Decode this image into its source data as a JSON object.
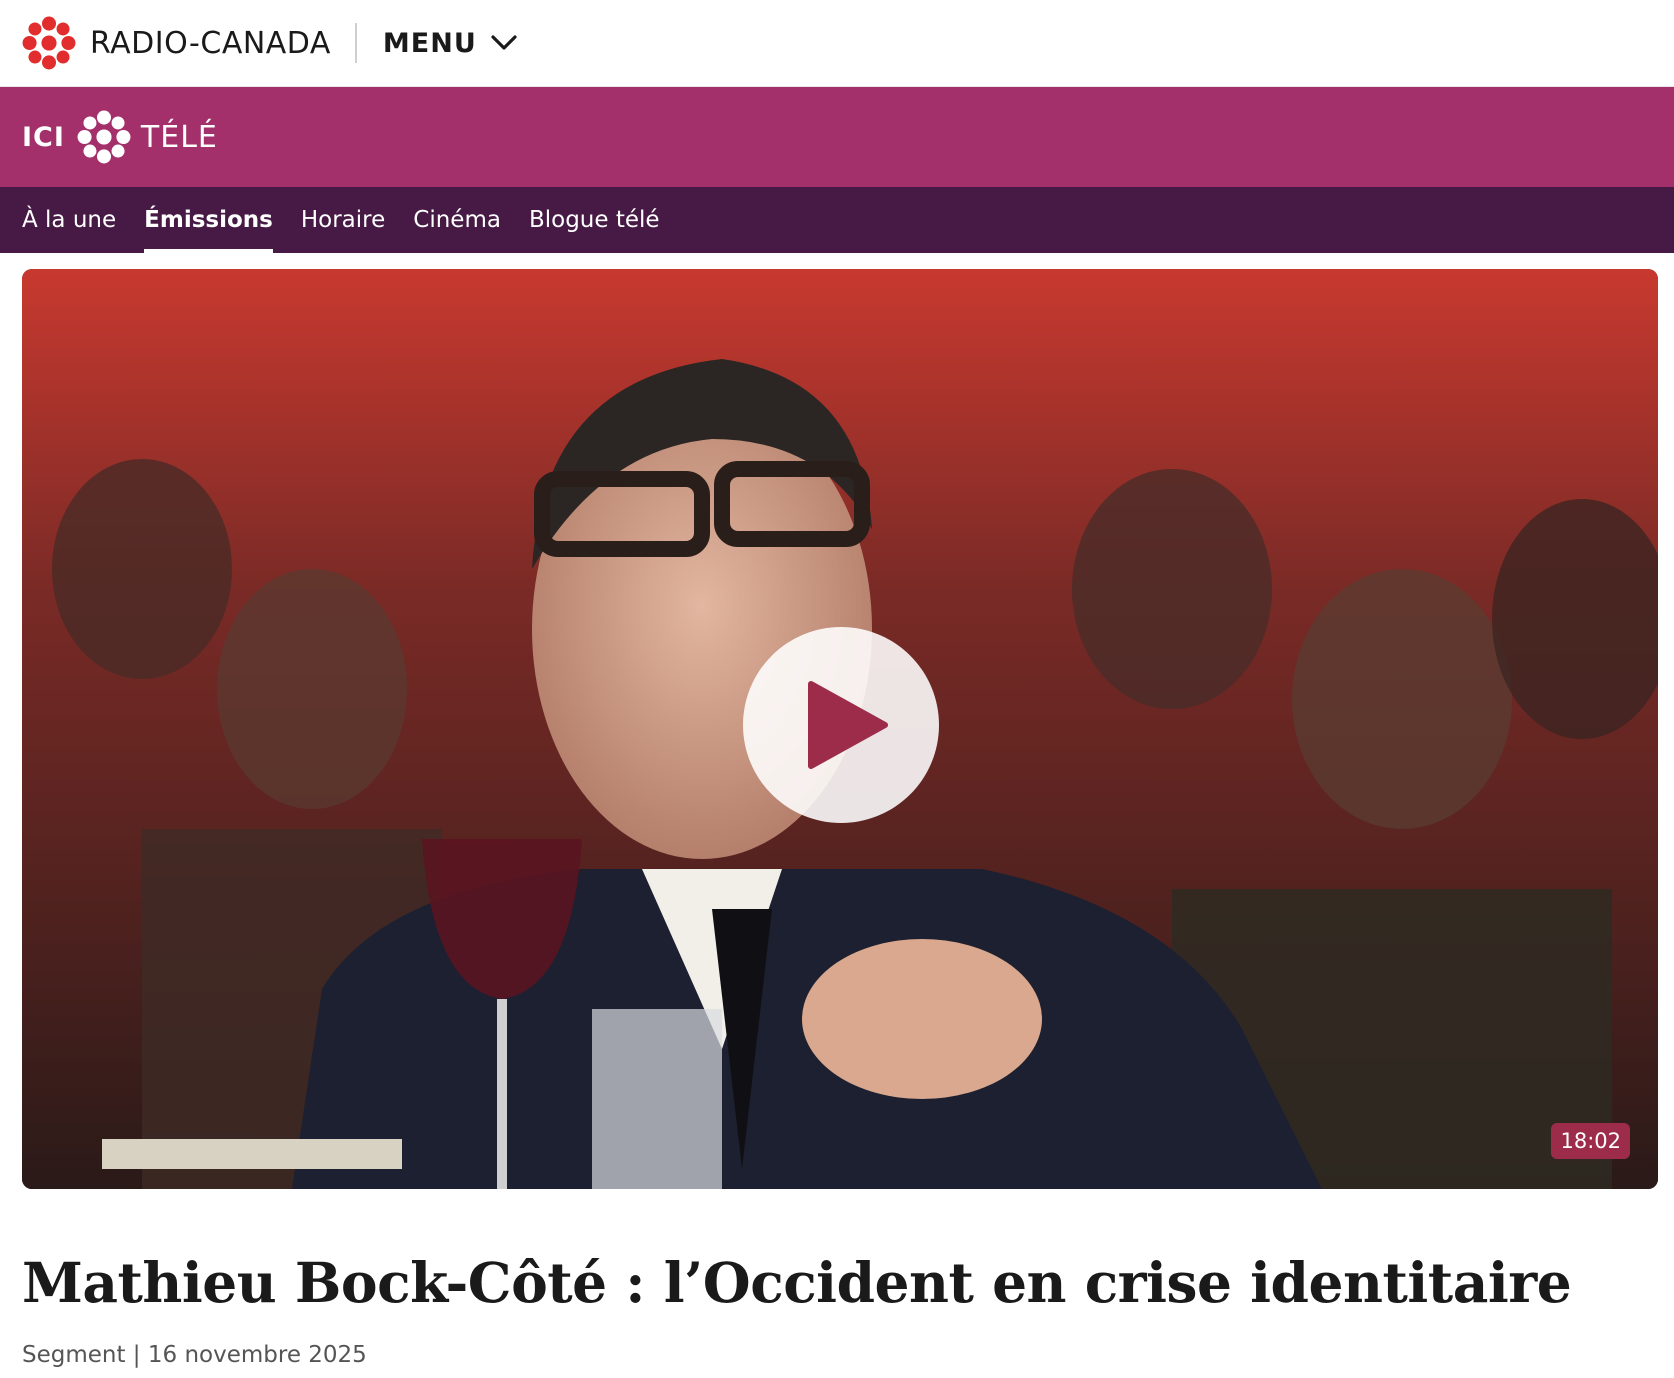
{
  "brand": {
    "wordmark": "RADIO-CANADA",
    "menu_label": "MENU",
    "accent_red": "#e12d2d"
  },
  "band": {
    "prefix": "ICI",
    "suffix": "TÉLÉ",
    "background": "#a3306b"
  },
  "nav": {
    "items": [
      {
        "label": "À la une",
        "active": false
      },
      {
        "label": "Émissions",
        "active": true
      },
      {
        "label": "Horaire",
        "active": false
      },
      {
        "label": "Cinéma",
        "active": false
      },
      {
        "label": "Blogue télé",
        "active": false
      }
    ],
    "background": "#461a44"
  },
  "video": {
    "duration": "18:02",
    "play_icon": "play-icon"
  },
  "article": {
    "title": "Mathieu Bock-Côté : l’Occident en crise identitaire",
    "meta": "Segment | 16 novembre 2025"
  }
}
